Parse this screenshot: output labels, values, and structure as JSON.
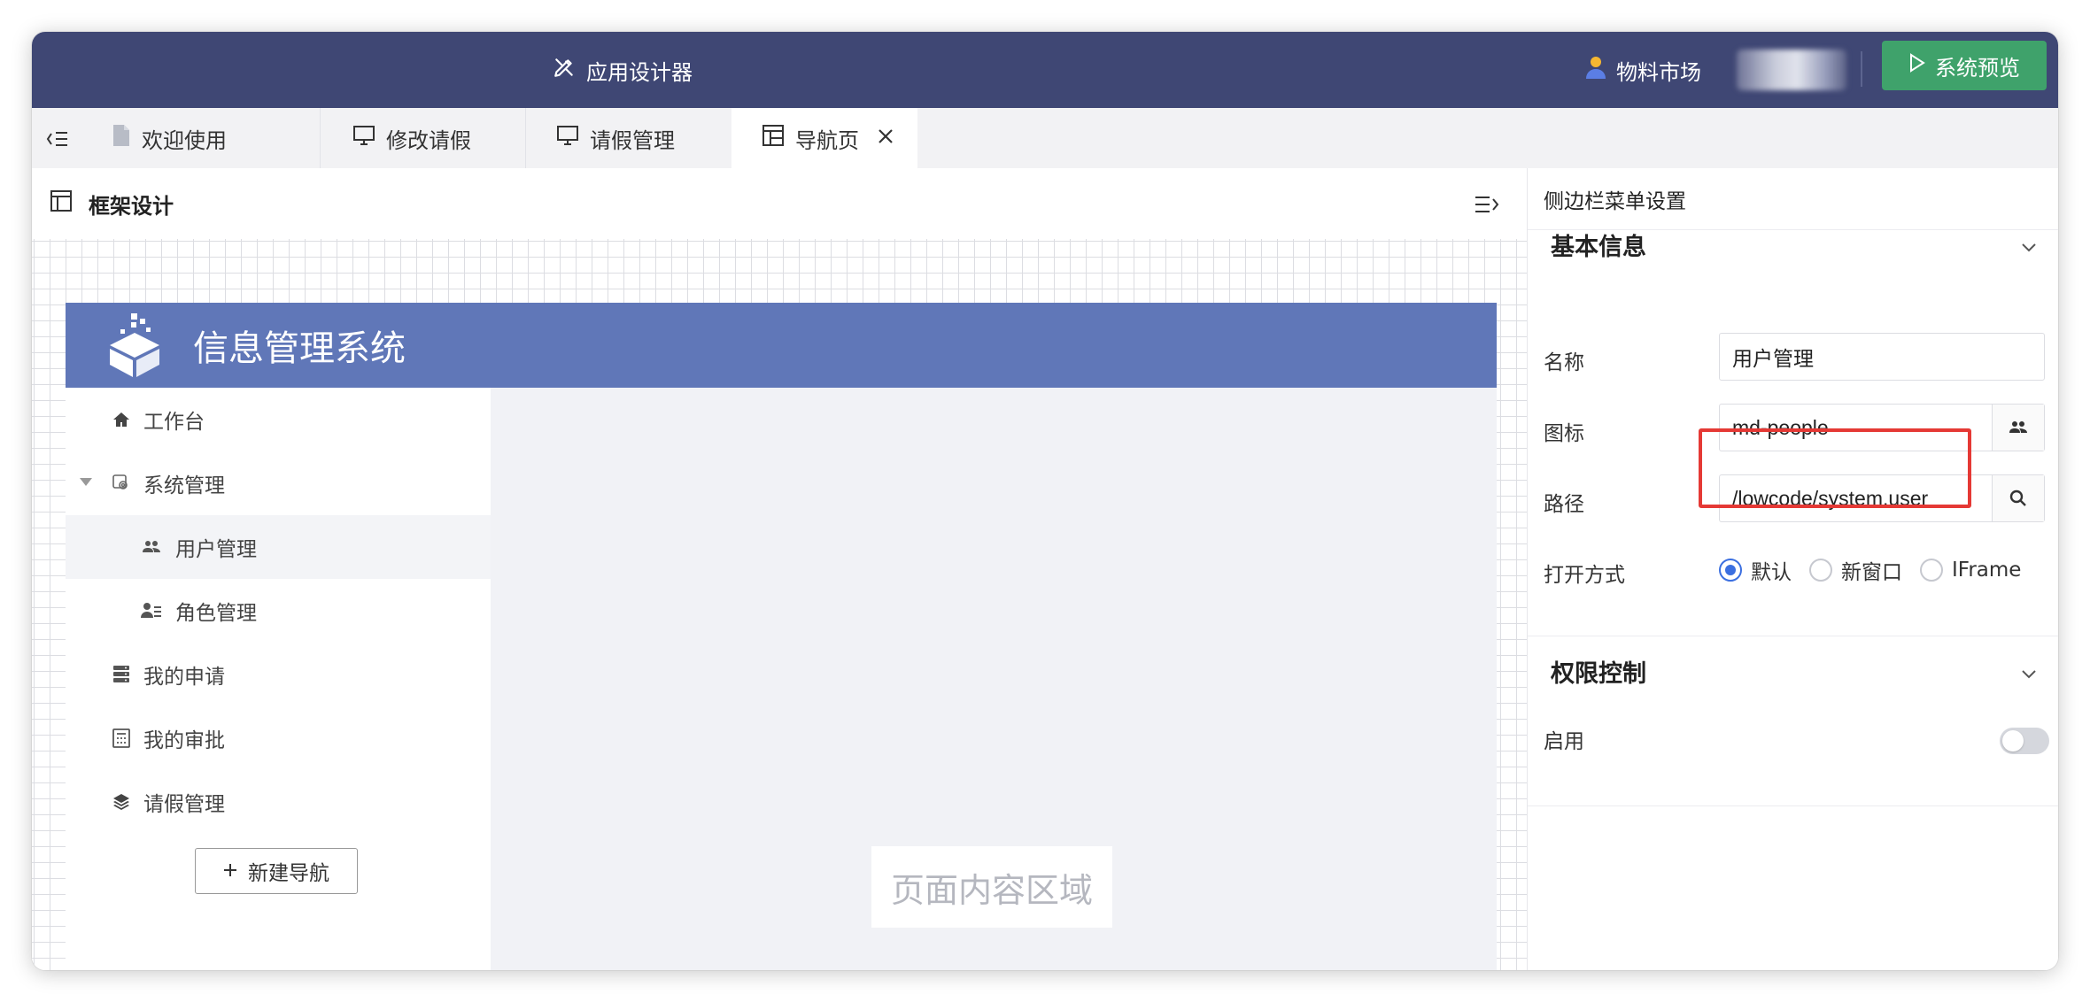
{
  "topbar": {
    "app_title": "应用设计器",
    "market_label": "物料市场",
    "preview_label": "系统预览"
  },
  "tabs": [
    {
      "label": "欢迎使用",
      "icon": "file-icon"
    },
    {
      "label": "修改请假",
      "icon": "monitor-icon"
    },
    {
      "label": "请假管理",
      "icon": "monitor-icon"
    },
    {
      "label": "导航页",
      "icon": "layout-icon",
      "active": true,
      "closable": true
    }
  ],
  "design": {
    "title": "框架设计",
    "system_title": "信息管理系统",
    "nav": [
      {
        "label": "工作台",
        "icon": "home-icon"
      },
      {
        "label": "系统管理",
        "icon": "settings-icon",
        "expanded": true
      },
      {
        "label": "用户管理",
        "icon": "people-icon",
        "sub": true,
        "selected": true
      },
      {
        "label": "角色管理",
        "icon": "role-icon",
        "sub": true
      },
      {
        "label": "我的申请",
        "icon": "storage-icon"
      },
      {
        "label": "我的审批",
        "icon": "calculator-icon"
      },
      {
        "label": "请假管理",
        "icon": "layers-icon"
      }
    ],
    "new_nav_label": "新建导航",
    "content_placeholder": "页面内容区域"
  },
  "settings": {
    "title": "侧边栏菜单设置",
    "basic_section": "基本信息",
    "name_label": "名称",
    "name_value": "用户管理",
    "icon_label": "图标",
    "icon_value": "md-people",
    "path_label": "路径",
    "path_value": "/lowcode/system.user",
    "open_label": "打开方式",
    "open_options": [
      "默认",
      "新窗口",
      "IFrame"
    ],
    "open_selected": "默认",
    "perm_section": "权限控制",
    "enable_label": "启用",
    "enable_value": false
  },
  "colors": {
    "topbar": "#3f4774",
    "preview_button": "#3fa26b",
    "mock_header": "#6077b8",
    "highlight": "#e53935",
    "radio_checked": "#3b6fe0"
  }
}
